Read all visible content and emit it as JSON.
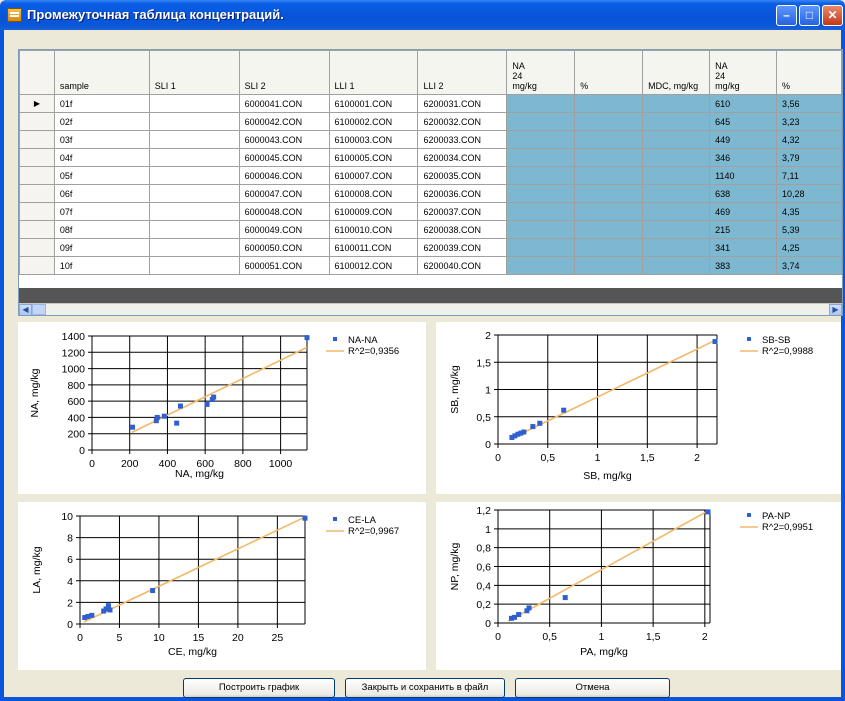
{
  "window": {
    "title": "Промежуточная таблица концентраций."
  },
  "table": {
    "columns": [
      "sample",
      "SLI 1",
      "SLI 2",
      "LLI 1",
      "LLI 2",
      "NA\n24\nmg/kg",
      "%",
      "MDC, mg/kg",
      "NA\n24\nmg/kg",
      "%"
    ],
    "rows": [
      [
        "01f",
        "",
        "6000041.CON",
        "6100001.CON",
        "6200031.CON",
        "",
        "",
        "",
        "610",
        "3,56"
      ],
      [
        "02f",
        "",
        "6000042.CON",
        "6100002.CON",
        "6200032.CON",
        "",
        "",
        "",
        "645",
        "3,23"
      ],
      [
        "03f",
        "",
        "6000043.CON",
        "6100003.CON",
        "6200033.CON",
        "",
        "",
        "",
        "449",
        "4,32"
      ],
      [
        "04f",
        "",
        "6000045.CON",
        "6100005.CON",
        "6200034.CON",
        "",
        "",
        "",
        "346",
        "3,79"
      ],
      [
        "05f",
        "",
        "6000046.CON",
        "6100007.CON",
        "6200035.CON",
        "",
        "",
        "",
        "1140",
        "7,11"
      ],
      [
        "06f",
        "",
        "6000047.CON",
        "6100008.CON",
        "6200036.CON",
        "",
        "",
        "",
        "638",
        "10,28"
      ],
      [
        "07f",
        "",
        "6000048.CON",
        "6100009.CON",
        "6200037.CON",
        "",
        "",
        "",
        "469",
        "4,35"
      ],
      [
        "08f",
        "",
        "6000049.CON",
        "6100010.CON",
        "6200038.CON",
        "",
        "",
        "",
        "215",
        "5,39"
      ],
      [
        "09f",
        "",
        "6000050.CON",
        "6100011.CON",
        "6200039.CON",
        "",
        "",
        "",
        "341",
        "4,25"
      ],
      [
        "10f",
        "",
        "6000051.CON",
        "6100012.CON",
        "6200040.CON",
        "",
        "",
        "",
        "383",
        "3,74"
      ]
    ],
    "current_row_marker": "▶",
    "highlight_color": "#7EB8D0"
  },
  "chart_data": [
    {
      "type": "scatter",
      "xlabel": "NA, mg/kg",
      "ylabel": "NA, mg/kg",
      "xlim": [
        0,
        1140
      ],
      "ylim": [
        0,
        1400
      ],
      "xticks": [
        0,
        200,
        400,
        600,
        800,
        1000
      ],
      "yticks": [
        0,
        200,
        400,
        600,
        800,
        1000,
        1200,
        1400
      ],
      "xtick_labels": [
        "0",
        "200",
        "400",
        "600",
        "800",
        "1000"
      ],
      "ytick_labels": [
        "0",
        "200",
        "400",
        "600",
        "800",
        "1000",
        "1200",
        "1400"
      ],
      "points": [
        [
          215,
          280
        ],
        [
          341,
          360
        ],
        [
          346,
          400
        ],
        [
          383,
          415
        ],
        [
          449,
          330
        ],
        [
          469,
          540
        ],
        [
          610,
          560
        ],
        [
          638,
          620
        ],
        [
          645,
          650
        ],
        [
          1140,
          1380
        ]
      ],
      "fit_line": [
        [
          210,
          215
        ],
        [
          1140,
          1260
        ]
      ],
      "legend": [
        "NA-NA",
        "R^2=0,9356"
      ],
      "point_color": "#2F5FD0",
      "line_color": "#F2B868"
    },
    {
      "type": "scatter",
      "xlabel": "SB, mg/kg",
      "ylabel": "SB, mg/kg",
      "xlim": [
        0,
        2.2
      ],
      "ylim": [
        0,
        2
      ],
      "xticks": [
        0,
        0.5,
        1,
        1.5,
        2
      ],
      "yticks": [
        0,
        0.5,
        1,
        1.5,
        2
      ],
      "xtick_labels": [
        "0",
        "0,5",
        "1",
        "1,5",
        "2"
      ],
      "ytick_labels": [
        "0",
        "0,5",
        "1",
        "1,5",
        "2"
      ],
      "points": [
        [
          0.14,
          0.12
        ],
        [
          0.17,
          0.15
        ],
        [
          0.2,
          0.18
        ],
        [
          0.23,
          0.2
        ],
        [
          0.26,
          0.22
        ],
        [
          0.35,
          0.32
        ],
        [
          0.42,
          0.38
        ],
        [
          0.66,
          0.62
        ],
        [
          2.18,
          1.88
        ]
      ],
      "fit_line": [
        [
          0.12,
          0.09
        ],
        [
          2.18,
          1.9
        ]
      ],
      "legend": [
        "SB-SB",
        "R^2=0,9988"
      ],
      "point_color": "#2F5FD0",
      "line_color": "#F2B868"
    },
    {
      "type": "scatter",
      "xlabel": "CE, mg/kg",
      "ylabel": "LA, mg/kg",
      "xlim": [
        0,
        28.5
      ],
      "ylim": [
        0,
        10
      ],
      "xticks": [
        0,
        5,
        10,
        15,
        20,
        25
      ],
      "yticks": [
        0,
        2,
        4,
        6,
        8,
        10
      ],
      "xtick_labels": [
        "0",
        "5",
        "10",
        "15",
        "20",
        "25"
      ],
      "ytick_labels": [
        "0",
        "2",
        "4",
        "6",
        "8",
        "10"
      ],
      "points": [
        [
          0.6,
          0.6
        ],
        [
          1.0,
          0.7
        ],
        [
          1.5,
          0.8
        ],
        [
          3.0,
          1.2
        ],
        [
          3.3,
          1.4
        ],
        [
          3.6,
          1.7
        ],
        [
          3.8,
          1.3
        ],
        [
          9.2,
          3.1
        ],
        [
          28.5,
          9.8
        ]
      ],
      "fit_line": [
        [
          0.5,
          0.2
        ],
        [
          28.5,
          9.9
        ]
      ],
      "legend": [
        "CE-LA",
        "R^2=0,9967"
      ],
      "point_color": "#2F5FD0",
      "line_color": "#F2B868"
    },
    {
      "type": "scatter",
      "xlabel": "PA, mg/kg",
      "ylabel": "NP, mg/kg",
      "xlim": [
        0,
        2.05
      ],
      "ylim": [
        0,
        1.2
      ],
      "xticks": [
        0,
        0.5,
        1,
        1.5,
        2
      ],
      "yticks": [
        0,
        0.2,
        0.4,
        0.6,
        0.8,
        1,
        1.2
      ],
      "xtick_labels": [
        "0",
        "0,5",
        "1",
        "1,5",
        "2"
      ],
      "ytick_labels": [
        "0",
        "0,2",
        "0,4",
        "0,6",
        "0,8",
        "1",
        "1,2"
      ],
      "points": [
        [
          0.13,
          0.05
        ],
        [
          0.16,
          0.06
        ],
        [
          0.2,
          0.09
        ],
        [
          0.28,
          0.13
        ],
        [
          0.3,
          0.16
        ],
        [
          0.65,
          0.27
        ],
        [
          2.03,
          1.18
        ]
      ],
      "fit_line": [
        [
          0.1,
          0.02
        ],
        [
          2.03,
          1.19
        ]
      ],
      "legend": [
        "PA-NP",
        "R^2=0,9951"
      ],
      "point_color": "#2F5FD0",
      "line_color": "#F2B868"
    }
  ],
  "buttons": {
    "build": "Построить график",
    "close_save": "Закрыть и сохранить в файл",
    "cancel": "Отмена"
  }
}
